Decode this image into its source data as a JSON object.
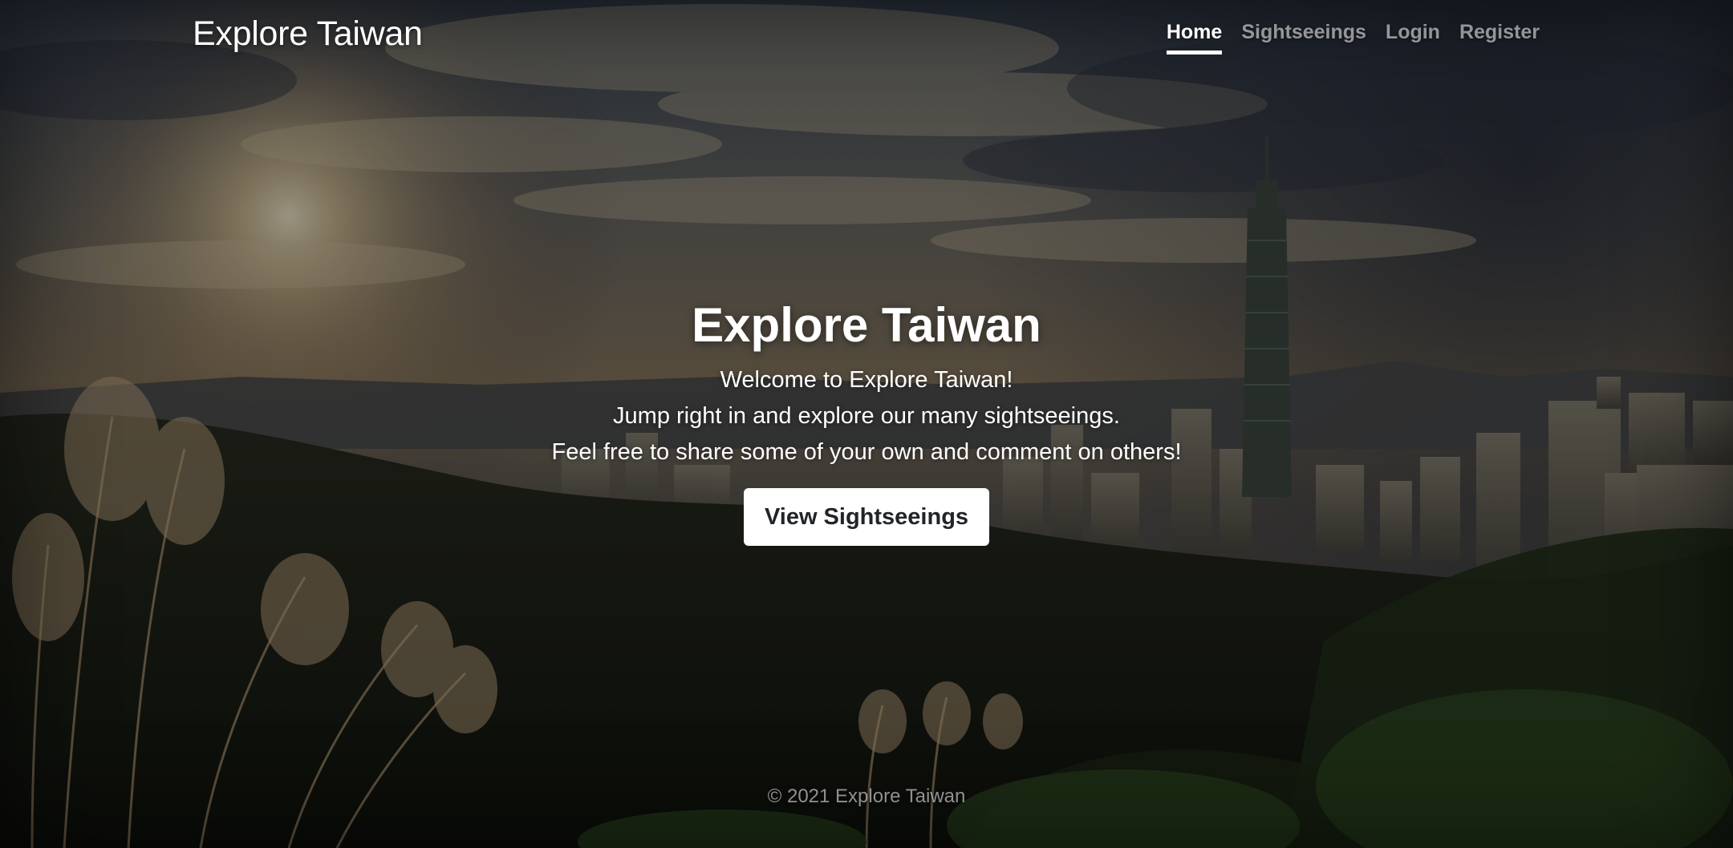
{
  "header": {
    "brand": "Explore Taiwan",
    "nav": [
      {
        "label": "Home",
        "active": true
      },
      {
        "label": "Sightseeings",
        "active": false
      },
      {
        "label": "Login",
        "active": false
      },
      {
        "label": "Register",
        "active": false
      }
    ]
  },
  "hero": {
    "title": "Explore Taiwan",
    "lead": [
      "Welcome to Explore Taiwan!",
      "Jump right in and explore our many sightseeings.",
      "Feel free to share some of your own and comment on others!"
    ],
    "button_label": "View Sightseeings"
  },
  "footer": {
    "text": "© 2021 Explore Taiwan"
  },
  "colors": {
    "button_bg": "#ffffff",
    "button_text": "#212529",
    "nav_inactive": "rgba(255,255,255,0.55)",
    "nav_active": "#ffffff"
  }
}
